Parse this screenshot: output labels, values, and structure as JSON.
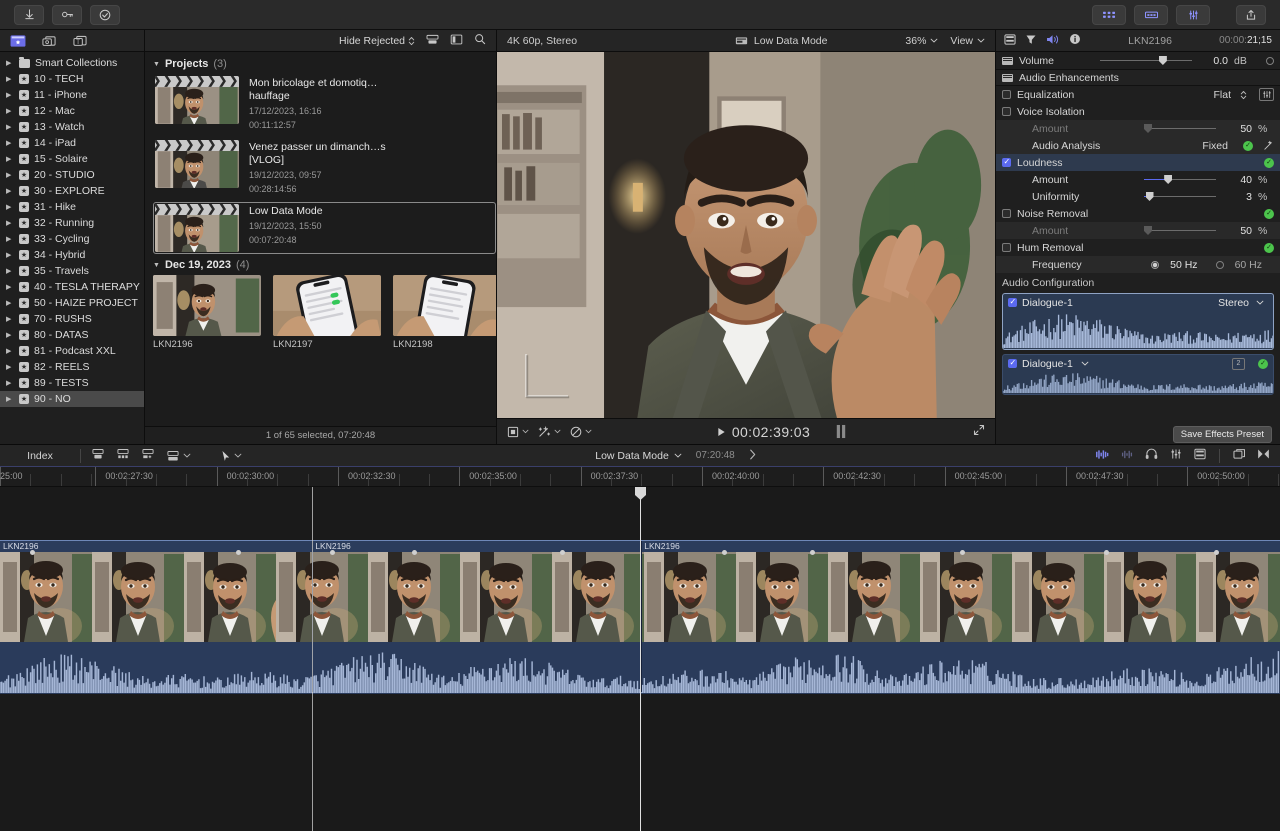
{
  "titlebar": {
    "left_buttons": [
      {
        "name": "import-media-button",
        "icon": "download-arrow-icon",
        "label": ""
      },
      {
        "name": "keywords-button",
        "icon": "key-icon",
        "label": ""
      },
      {
        "name": "keyword-check-button",
        "icon": "check-circle-icon",
        "label": ""
      }
    ],
    "right_buttons": [
      {
        "name": "effects-browser-button",
        "icon": "effects-grid-icon",
        "label": ""
      },
      {
        "name": "titles-generators-button",
        "icon": "titles-icon",
        "label": ""
      },
      {
        "name": "color-inspector-button",
        "icon": "sliders-icon",
        "label": ""
      },
      {
        "name": "share-button",
        "icon": "share-icon",
        "label": ""
      }
    ]
  },
  "sidebar": {
    "tabs": [
      {
        "name": "libraries-tab",
        "icon": "library-icon",
        "active": true
      },
      {
        "name": "photos-audio-tab",
        "icon": "photos-audio-icon",
        "active": false
      },
      {
        "name": "titles-tab",
        "icon": "titles-generators-icon",
        "active": false
      }
    ],
    "items": [
      {
        "label": "Smart Collections",
        "icon": "folder-icon",
        "selected": false
      },
      {
        "label": "10 - TECH",
        "icon": "event-icon",
        "selected": false
      },
      {
        "label": "11 - iPhone",
        "icon": "event-icon",
        "selected": false
      },
      {
        "label": "12 - Mac",
        "icon": "event-icon",
        "selected": false
      },
      {
        "label": "13 - Watch",
        "icon": "event-icon",
        "selected": false
      },
      {
        "label": "14 - iPad",
        "icon": "event-icon",
        "selected": false
      },
      {
        "label": "15 - Solaire",
        "icon": "event-icon",
        "selected": false
      },
      {
        "label": "20 - STUDIO",
        "icon": "event-icon",
        "selected": false
      },
      {
        "label": "30 - EXPLORE",
        "icon": "event-icon",
        "selected": false
      },
      {
        "label": "31 - Hike",
        "icon": "event-icon",
        "selected": false
      },
      {
        "label": "32 - Running",
        "icon": "event-icon",
        "selected": false
      },
      {
        "label": "33 - Cycling",
        "icon": "event-icon",
        "selected": false
      },
      {
        "label": "34 - Hybrid",
        "icon": "event-icon",
        "selected": false
      },
      {
        "label": "35 - Travels",
        "icon": "event-icon",
        "selected": false
      },
      {
        "label": "40 - TESLA THERAPY",
        "icon": "event-icon",
        "selected": false
      },
      {
        "label": "50 - HAIZE PROJECT",
        "icon": "event-icon",
        "selected": false
      },
      {
        "label": "70 - RUSHS",
        "icon": "event-icon",
        "selected": false
      },
      {
        "label": "80 - DATAS",
        "icon": "event-icon",
        "selected": false
      },
      {
        "label": "81 - Podcast XXL",
        "icon": "event-icon",
        "selected": false
      },
      {
        "label": "82 - REELS",
        "icon": "event-icon",
        "selected": false
      },
      {
        "label": "89 - TESTS",
        "icon": "event-icon",
        "selected": false
      },
      {
        "label": "90 - NO",
        "icon": "event-icon",
        "selected": true
      }
    ]
  },
  "browser": {
    "toolbar": {
      "filter_label": "Hide Rejected",
      "icons": [
        "filmstrip-view-icon",
        "list-view-icon",
        "search-icon"
      ]
    },
    "groups": [
      {
        "title": "Projects",
        "count": "(3)",
        "type": "projects",
        "items": [
          {
            "title": "Mon bricolage et domotiq…hauffage",
            "date": "17/12/2023, 16:16",
            "duration": "00:11:12:57",
            "selected": false
          },
          {
            "title": "Venez passer un dimanch…s [VLOG]",
            "date": "19/12/2023, 09:57",
            "duration": "00:28:14:56",
            "selected": false
          },
          {
            "title": "Low Data Mode",
            "date": "19/12/2023, 15:50",
            "duration": "00:07:20:48",
            "selected": true
          }
        ]
      },
      {
        "title": "Dec 19, 2023",
        "count": "(4)",
        "type": "clips",
        "items": [
          {
            "name": "LKN2196"
          },
          {
            "name": "LKN2197"
          },
          {
            "name": "LKN2198"
          }
        ]
      }
    ],
    "status": "1 of 65 selected, 07:20:48"
  },
  "viewer": {
    "format": "4K 60p, Stereo",
    "project_name": "Low Data Mode",
    "zoom": "36%",
    "view_menu": "View",
    "timecode": "00:02:39:03",
    "transport_icons": [
      "crop-transform-icon",
      "enhancements-icon",
      "color-balance-icon"
    ],
    "fullscreen_icon": "expand-icon"
  },
  "inspector": {
    "tabs": [
      "video-inspector-icon",
      "color-inspector-icon",
      "audio-inspector-icon",
      "info-inspector-icon"
    ],
    "clip_name": "LKN2196",
    "timecode_prefix": "00:00:",
    "timecode_value": "21;15",
    "volume": {
      "label": "Volume",
      "value": "0.0",
      "unit": "dB"
    },
    "section_title": "Audio Enhancements",
    "rows": [
      {
        "label": "Equalization",
        "type": "checkbox",
        "checked": false,
        "right_text": "Flat",
        "has_menu": true,
        "has_eq_button": true
      },
      {
        "label": "Voice Isolation",
        "type": "checkbox",
        "checked": false
      },
      {
        "label": "Amount",
        "type": "slider",
        "indent": true,
        "dimmed": true,
        "value": "50",
        "unit": "%",
        "fill": 0
      },
      {
        "label": "Audio Analysis",
        "type": "text",
        "indent": true,
        "right_text": "Fixed",
        "green": true,
        "magic": true
      },
      {
        "label": "Loudness",
        "type": "checkbox",
        "checked": true,
        "green": true,
        "highlight": true
      },
      {
        "label": "Amount",
        "type": "slider",
        "indent": true,
        "value": "40",
        "unit": "%",
        "fill": 40
      },
      {
        "label": "Uniformity",
        "type": "slider",
        "indent": true,
        "value": "3",
        "unit": "%",
        "fill": 3
      },
      {
        "label": "Noise Removal",
        "type": "checkbox",
        "checked": false,
        "green": true
      },
      {
        "label": "Amount",
        "type": "slider",
        "indent": true,
        "dimmed": true,
        "value": "50",
        "unit": "%",
        "fill": 0
      },
      {
        "label": "Hum Removal",
        "type": "checkbox",
        "checked": false,
        "green": true
      },
      {
        "label": "Frequency",
        "type": "radio",
        "indent": true,
        "options": [
          "50 Hz",
          "60 Hz"
        ],
        "selected": 0
      }
    ],
    "audio_config": {
      "title": "Audio Configuration",
      "components": [
        {
          "label": "Dialogue-1",
          "checked": true,
          "mode": "Stereo",
          "active": true
        },
        {
          "label": "Dialogue-1",
          "checked": true,
          "badge": "2",
          "green": true,
          "active": false
        }
      ]
    },
    "save_preset_label": "Save Effects Preset"
  },
  "timeline": {
    "index_label": "Index",
    "toolbar_icons": [
      "append-icon",
      "insert-icon",
      "connect-icon",
      "overwrite-icon",
      "tool-select-icon"
    ],
    "project_name": "Low Data Mode",
    "duration": "07:20:48",
    "prev_icon": "chevron-left-icon",
    "next_icon": "chevron-right-icon",
    "right_icons": [
      "audio-skimming-icon",
      "solo-icon",
      "audio-meters-icon",
      "effects-icon",
      "index-icon",
      "zoom-fit-icon",
      "clip-appearance-icon"
    ],
    "ruler_labels": [
      "25:00",
      "00:02:27:30",
      "00:02:30:00",
      "00:02:32:30",
      "00:02:35:00",
      "00:02:37:30",
      "00:02:40:00",
      "00:02:42:30",
      "00:02:45:00",
      "00:02:47:30",
      "00:02:50:00"
    ],
    "clips": [
      {
        "label": "LKN2196",
        "start_pct": 0
      },
      {
        "label": "LKN2196",
        "start_pct": 24.4
      },
      {
        "label": "LKN2196",
        "start_pct": 50.1
      }
    ],
    "playhead_pct": 50.0,
    "skimmer_pct": 24.4
  }
}
